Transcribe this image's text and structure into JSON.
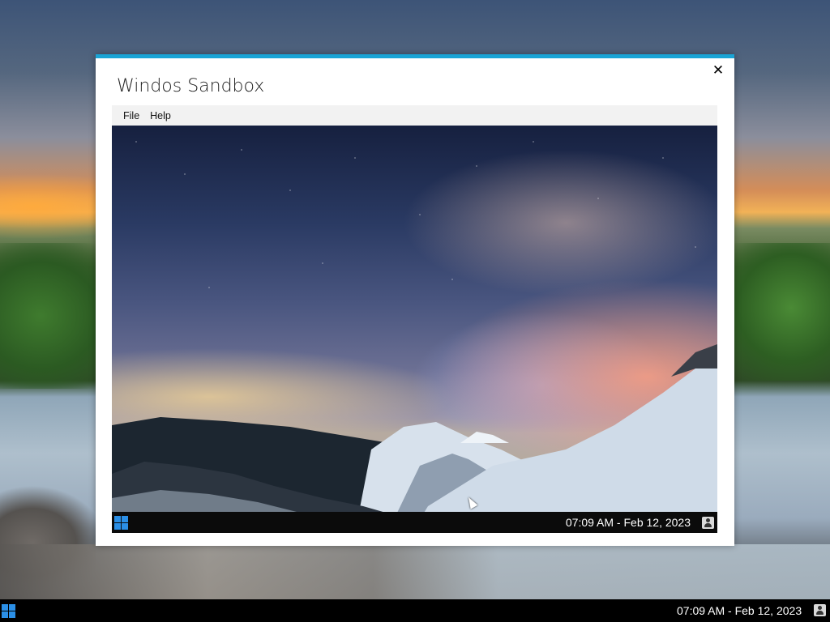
{
  "window": {
    "title": "Windos Sandbox",
    "close_symbol": "✕",
    "accent_color": "#1aa4d5"
  },
  "menu": {
    "items": [
      {
        "label": "File"
      },
      {
        "label": "Help"
      }
    ]
  },
  "vm": {
    "taskbar": {
      "clock": "07:09 AM - Feb 12, 2023",
      "start_icon": "windows-logo-icon",
      "user_icon": "user-icon"
    }
  },
  "host": {
    "taskbar": {
      "clock": "07:09 AM - Feb 12, 2023",
      "start_icon": "windows-logo-icon",
      "user_icon": "user-icon"
    }
  }
}
